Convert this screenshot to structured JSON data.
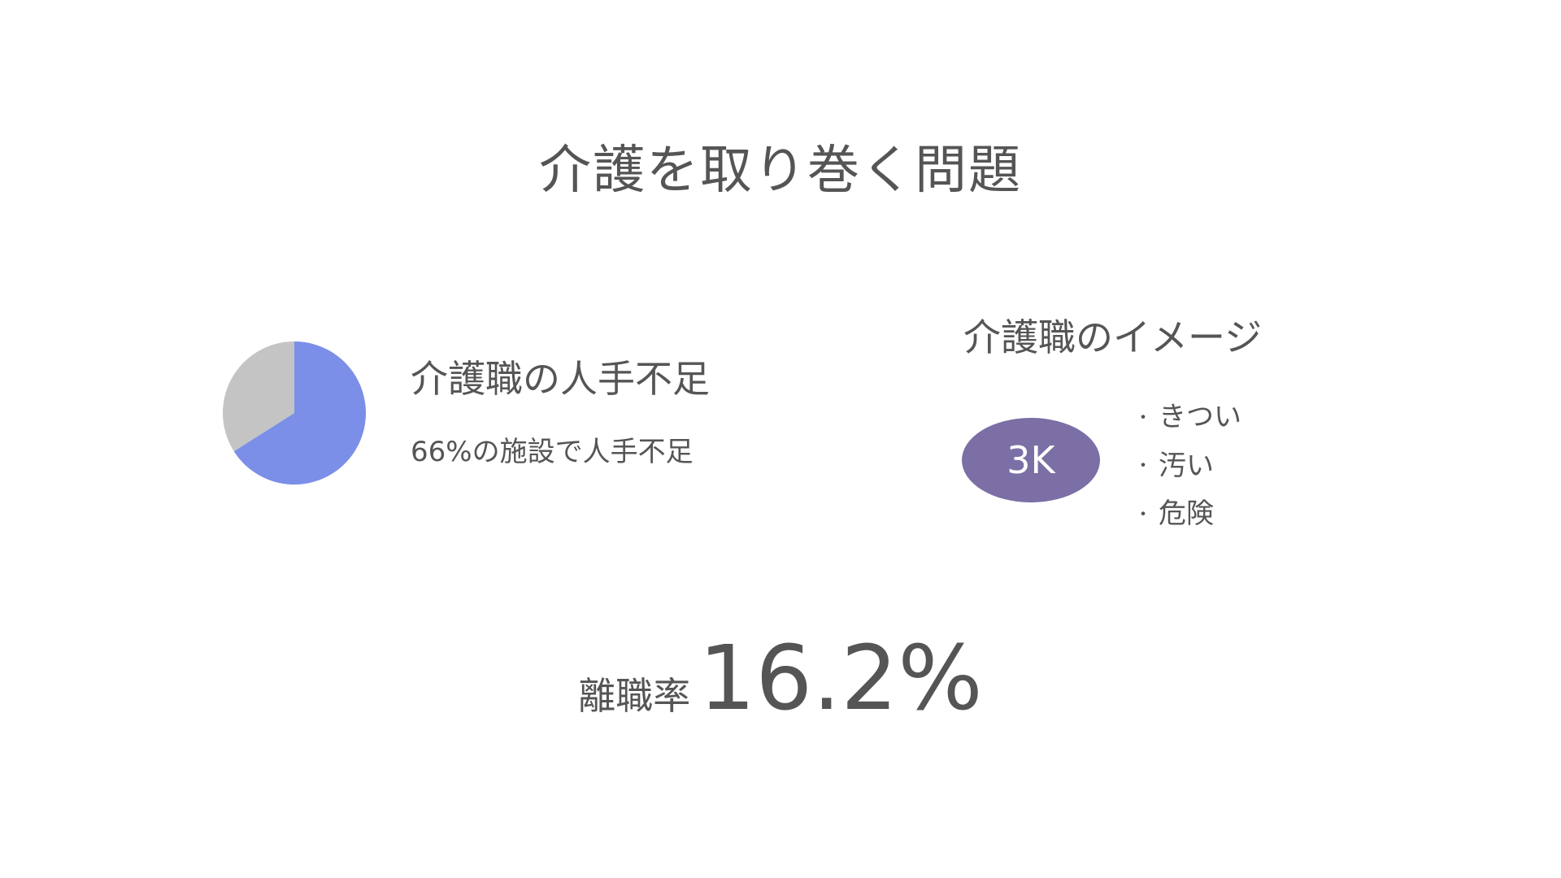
{
  "slide": {
    "title": "介護を取り巻く問題"
  },
  "shortage": {
    "heading": "介護職の人手不足",
    "detail": "66%の施設で人手不足"
  },
  "chart_data": {
    "type": "pie",
    "slices": [
      {
        "value": 66,
        "color": "#7b8fe8"
      },
      {
        "value": 34,
        "color": "#c4c4c4"
      }
    ]
  },
  "image_section": {
    "heading": "介護職のイメージ",
    "badge": "3K",
    "bullet": "・",
    "items": [
      "きつい",
      "汚い",
      "危険"
    ]
  },
  "turnover": {
    "label": "離職率",
    "value": "16.2%"
  },
  "colors": {
    "text": "#555555",
    "badge": "#7b6fa6",
    "pie_main": "#7b8fe8",
    "pie_rest": "#c4c4c4"
  }
}
